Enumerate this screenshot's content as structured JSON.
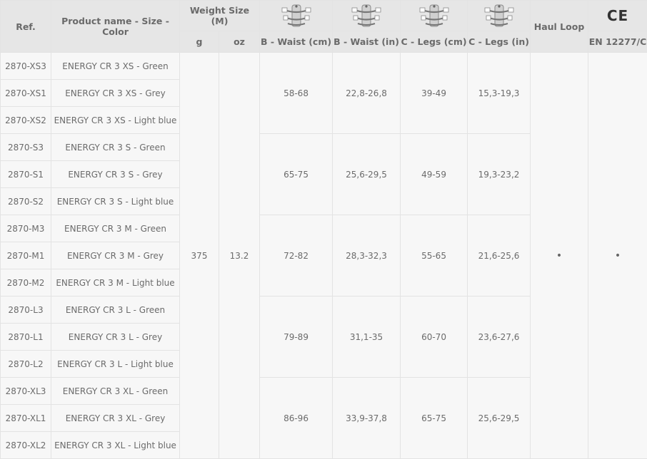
{
  "header": {
    "ref": "Ref.",
    "product": "Product name - Size - Color",
    "weight": "Weight Size (M)",
    "g": "g",
    "oz": "oz",
    "waist_cm": "B - Waist (cm)",
    "waist_in": "B - Waist (in)",
    "legs_cm": "C - Legs (cm)",
    "legs_in": "C - Legs (in)",
    "haul_loop": "Haul Loop",
    "ce_mark": "CE",
    "standard": "EN 12277/C",
    "diagram_icon": "harness-diagram-icon"
  },
  "weight": {
    "g": "375",
    "oz": "13.2"
  },
  "haul_loop": "•",
  "en12277": "•",
  "rows": [
    {
      "ref": "2870-XS3",
      "name": "ENERGY CR 3 XS - Green"
    },
    {
      "ref": "2870-XS1",
      "name": "ENERGY CR 3 XS - Grey"
    },
    {
      "ref": "2870-XS2",
      "name": "ENERGY CR 3 XS - Light blue"
    },
    {
      "ref": "2870-S3",
      "name": "ENERGY CR 3 S - Green"
    },
    {
      "ref": "2870-S1",
      "name": "ENERGY CR 3 S - Grey"
    },
    {
      "ref": "2870-S2",
      "name": "ENERGY CR 3 S - Light blue"
    },
    {
      "ref": "2870-M3",
      "name": "ENERGY CR 3 M - Green"
    },
    {
      "ref": "2870-M1",
      "name": "ENERGY CR 3 M - Grey"
    },
    {
      "ref": "2870-M2",
      "name": "ENERGY CR 3 M - Light blue"
    },
    {
      "ref": "2870-L3",
      "name": "ENERGY CR 3 L - Green"
    },
    {
      "ref": "2870-L1",
      "name": "ENERGY CR 3 L - Grey"
    },
    {
      "ref": "2870-L2",
      "name": "ENERGY CR 3 L - Light blue"
    },
    {
      "ref": "2870-XL3",
      "name": "ENERGY CR 3 XL - Green"
    },
    {
      "ref": "2870-XL1",
      "name": "ENERGY CR 3 XL - Grey"
    },
    {
      "ref": "2870-XL2",
      "name": "ENERGY CR 3 XL - Light blue"
    }
  ],
  "sizes": [
    {
      "waist_cm": "58-68",
      "waist_in": "22,8-26,8",
      "legs_cm": "39-49",
      "legs_in": "15,3-19,3"
    },
    {
      "waist_cm": "65-75",
      "waist_in": "25,6-29,5",
      "legs_cm": "49-59",
      "legs_in": "19,3-23,2"
    },
    {
      "waist_cm": "72-82",
      "waist_in": "28,3-32,3",
      "legs_cm": "55-65",
      "legs_in": "21,6-25,6"
    },
    {
      "waist_cm": "79-89",
      "waist_in": "31,1-35",
      "legs_cm": "60-70",
      "legs_in": "23,6-27,6"
    },
    {
      "waist_cm": "86-96",
      "waist_in": "33,9-37,8",
      "legs_cm": "65-75",
      "legs_in": "25,6-29,5"
    }
  ]
}
